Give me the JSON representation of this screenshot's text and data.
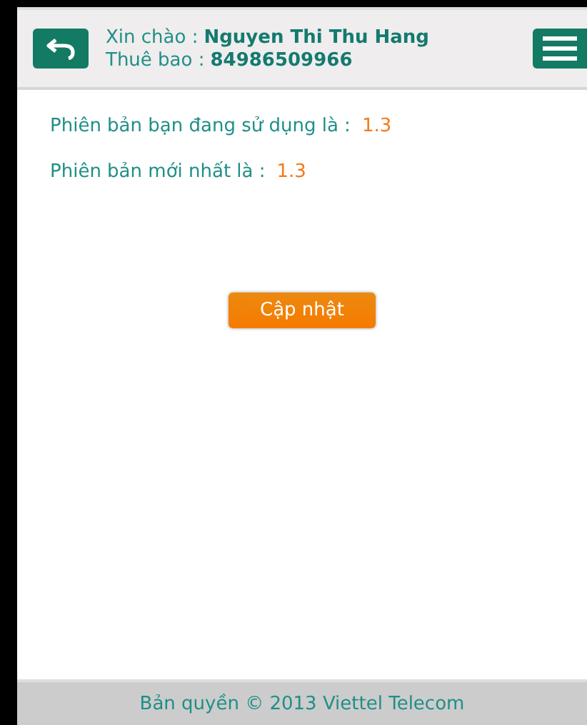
{
  "header": {
    "greeting": {
      "label": "Xin chào :",
      "value": "Nguyen Thi Thu Hang"
    },
    "subscriber": {
      "label": "Thuê bao :",
      "value": "84986509966"
    }
  },
  "versions": [
    {
      "label": "Phiên bản bạn đang sử dụng là :",
      "value": "1.3"
    },
    {
      "label": "Phiên bản mới nhất là :",
      "value": "1.3"
    }
  ],
  "update_button": "Cập nhật",
  "footer": "Bản quyền © 2013 Viettel Telecom"
}
